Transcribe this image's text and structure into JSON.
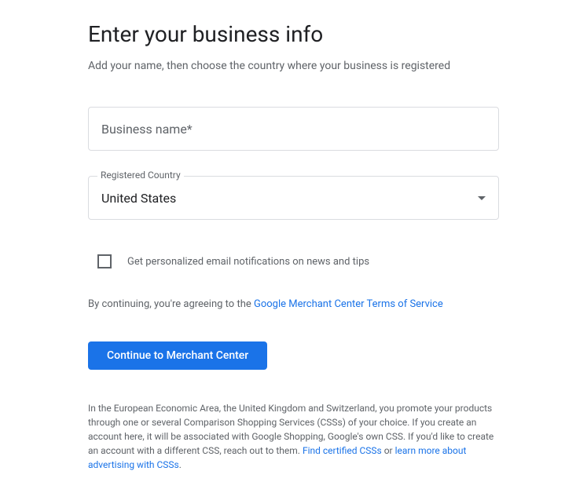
{
  "header": {
    "title": "Enter your business info",
    "subtitle": "Add your name, then choose the country where your business is registered"
  },
  "form": {
    "business_name_placeholder": "Business name*",
    "country_label": "Registered Country",
    "country_value": "United States",
    "checkbox_label": "Get personalized email notifications on news and tips"
  },
  "terms": {
    "prefix": "By continuing, you're agreeing to the ",
    "link_text": "Google Merchant Center Terms of Service"
  },
  "button": {
    "continue_label": "Continue to Merchant Center"
  },
  "footer": {
    "text": "In the European Economic Area, the United Kingdom and Switzerland, you promote your products through one or several Comparison Shopping Services (CSSs) of your choice. If you create an account here, it will be associated with Google Shopping, Google's own CSS. If you'd like to create an account with a different CSS, reach out to them. ",
    "link1_text": "Find certified CSSs",
    "middle_text": " or ",
    "link2_text": "learn more about advertising with CSSs",
    "period": "."
  }
}
